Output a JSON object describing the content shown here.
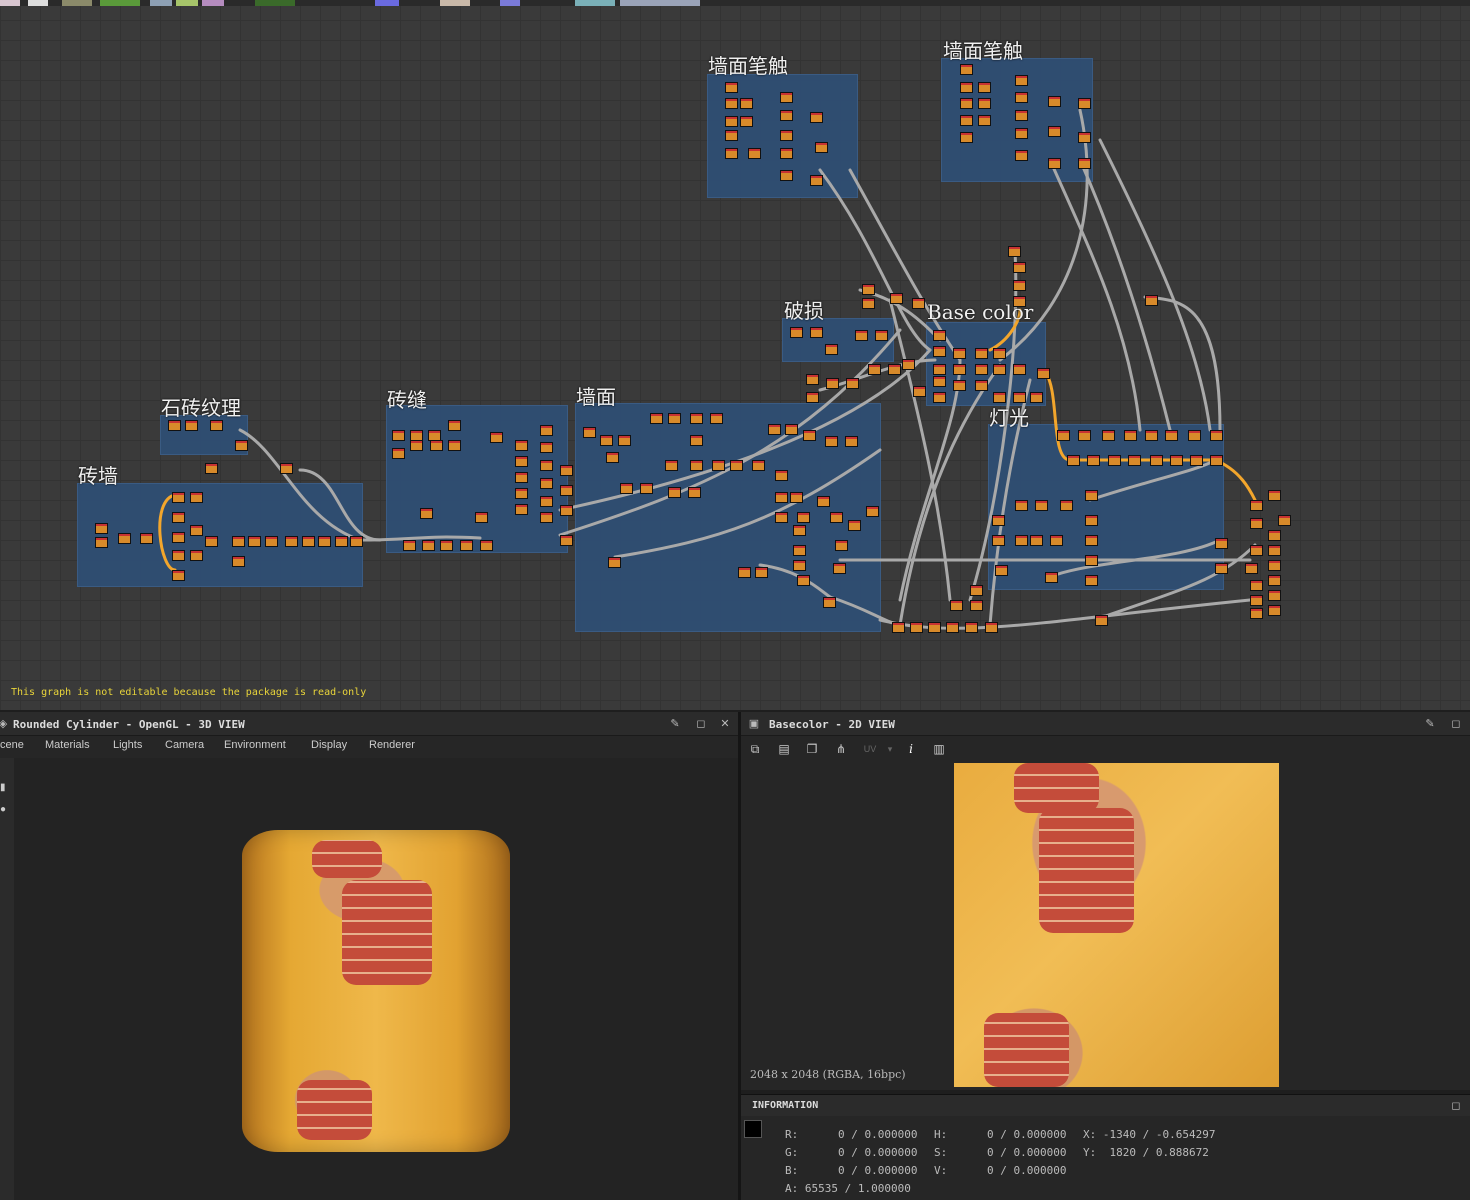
{
  "graph": {
    "frames": [
      {
        "title": "墙面笔触"
      },
      {
        "title": "墙面笔触"
      },
      {
        "title": "破损"
      },
      {
        "title": "Base color"
      },
      {
        "title": "灯光"
      },
      {
        "title": "石砖纹理"
      },
      {
        "title": "砖缝"
      },
      {
        "title": "墙面"
      },
      {
        "title": "砖墙"
      }
    ],
    "readonly_message": "This graph is not editable because the package is read-only",
    "frame_color": "#2f4e73",
    "wire_color": "#a9a9a9",
    "highlight_wire_color": "#f3a62c"
  },
  "view3d": {
    "title": "Rounded Cylinder - OpenGL - 3D VIEW",
    "menu": [
      "cene",
      "Materials",
      "Lights",
      "Camera",
      "Environment",
      "Display",
      "Renderer"
    ],
    "icons": [
      "cube-icon",
      "pin-icon",
      "maximize-icon",
      "close-icon"
    ]
  },
  "view2d": {
    "title": "Basecolor - 2D VIEW",
    "toolbar": {
      "uv_label": "UV"
    },
    "resolution": "2048 x 2048 (RGBA, 16bpc)"
  },
  "info": {
    "title": "INFORMATION",
    "r": "R:      0 / 0.000000",
    "g": "G:      0 / 0.000000",
    "b": "B:      0 / 0.000000",
    "a": "A: 65535 / 1.000000",
    "h": "H:      0 / 0.000000",
    "s": "S:      0 / 0.000000",
    "v": "V:      0 / 0.000000",
    "x": "X: -1340 / -0.654297",
    "y": "Y:  1820 / 0.888672"
  }
}
